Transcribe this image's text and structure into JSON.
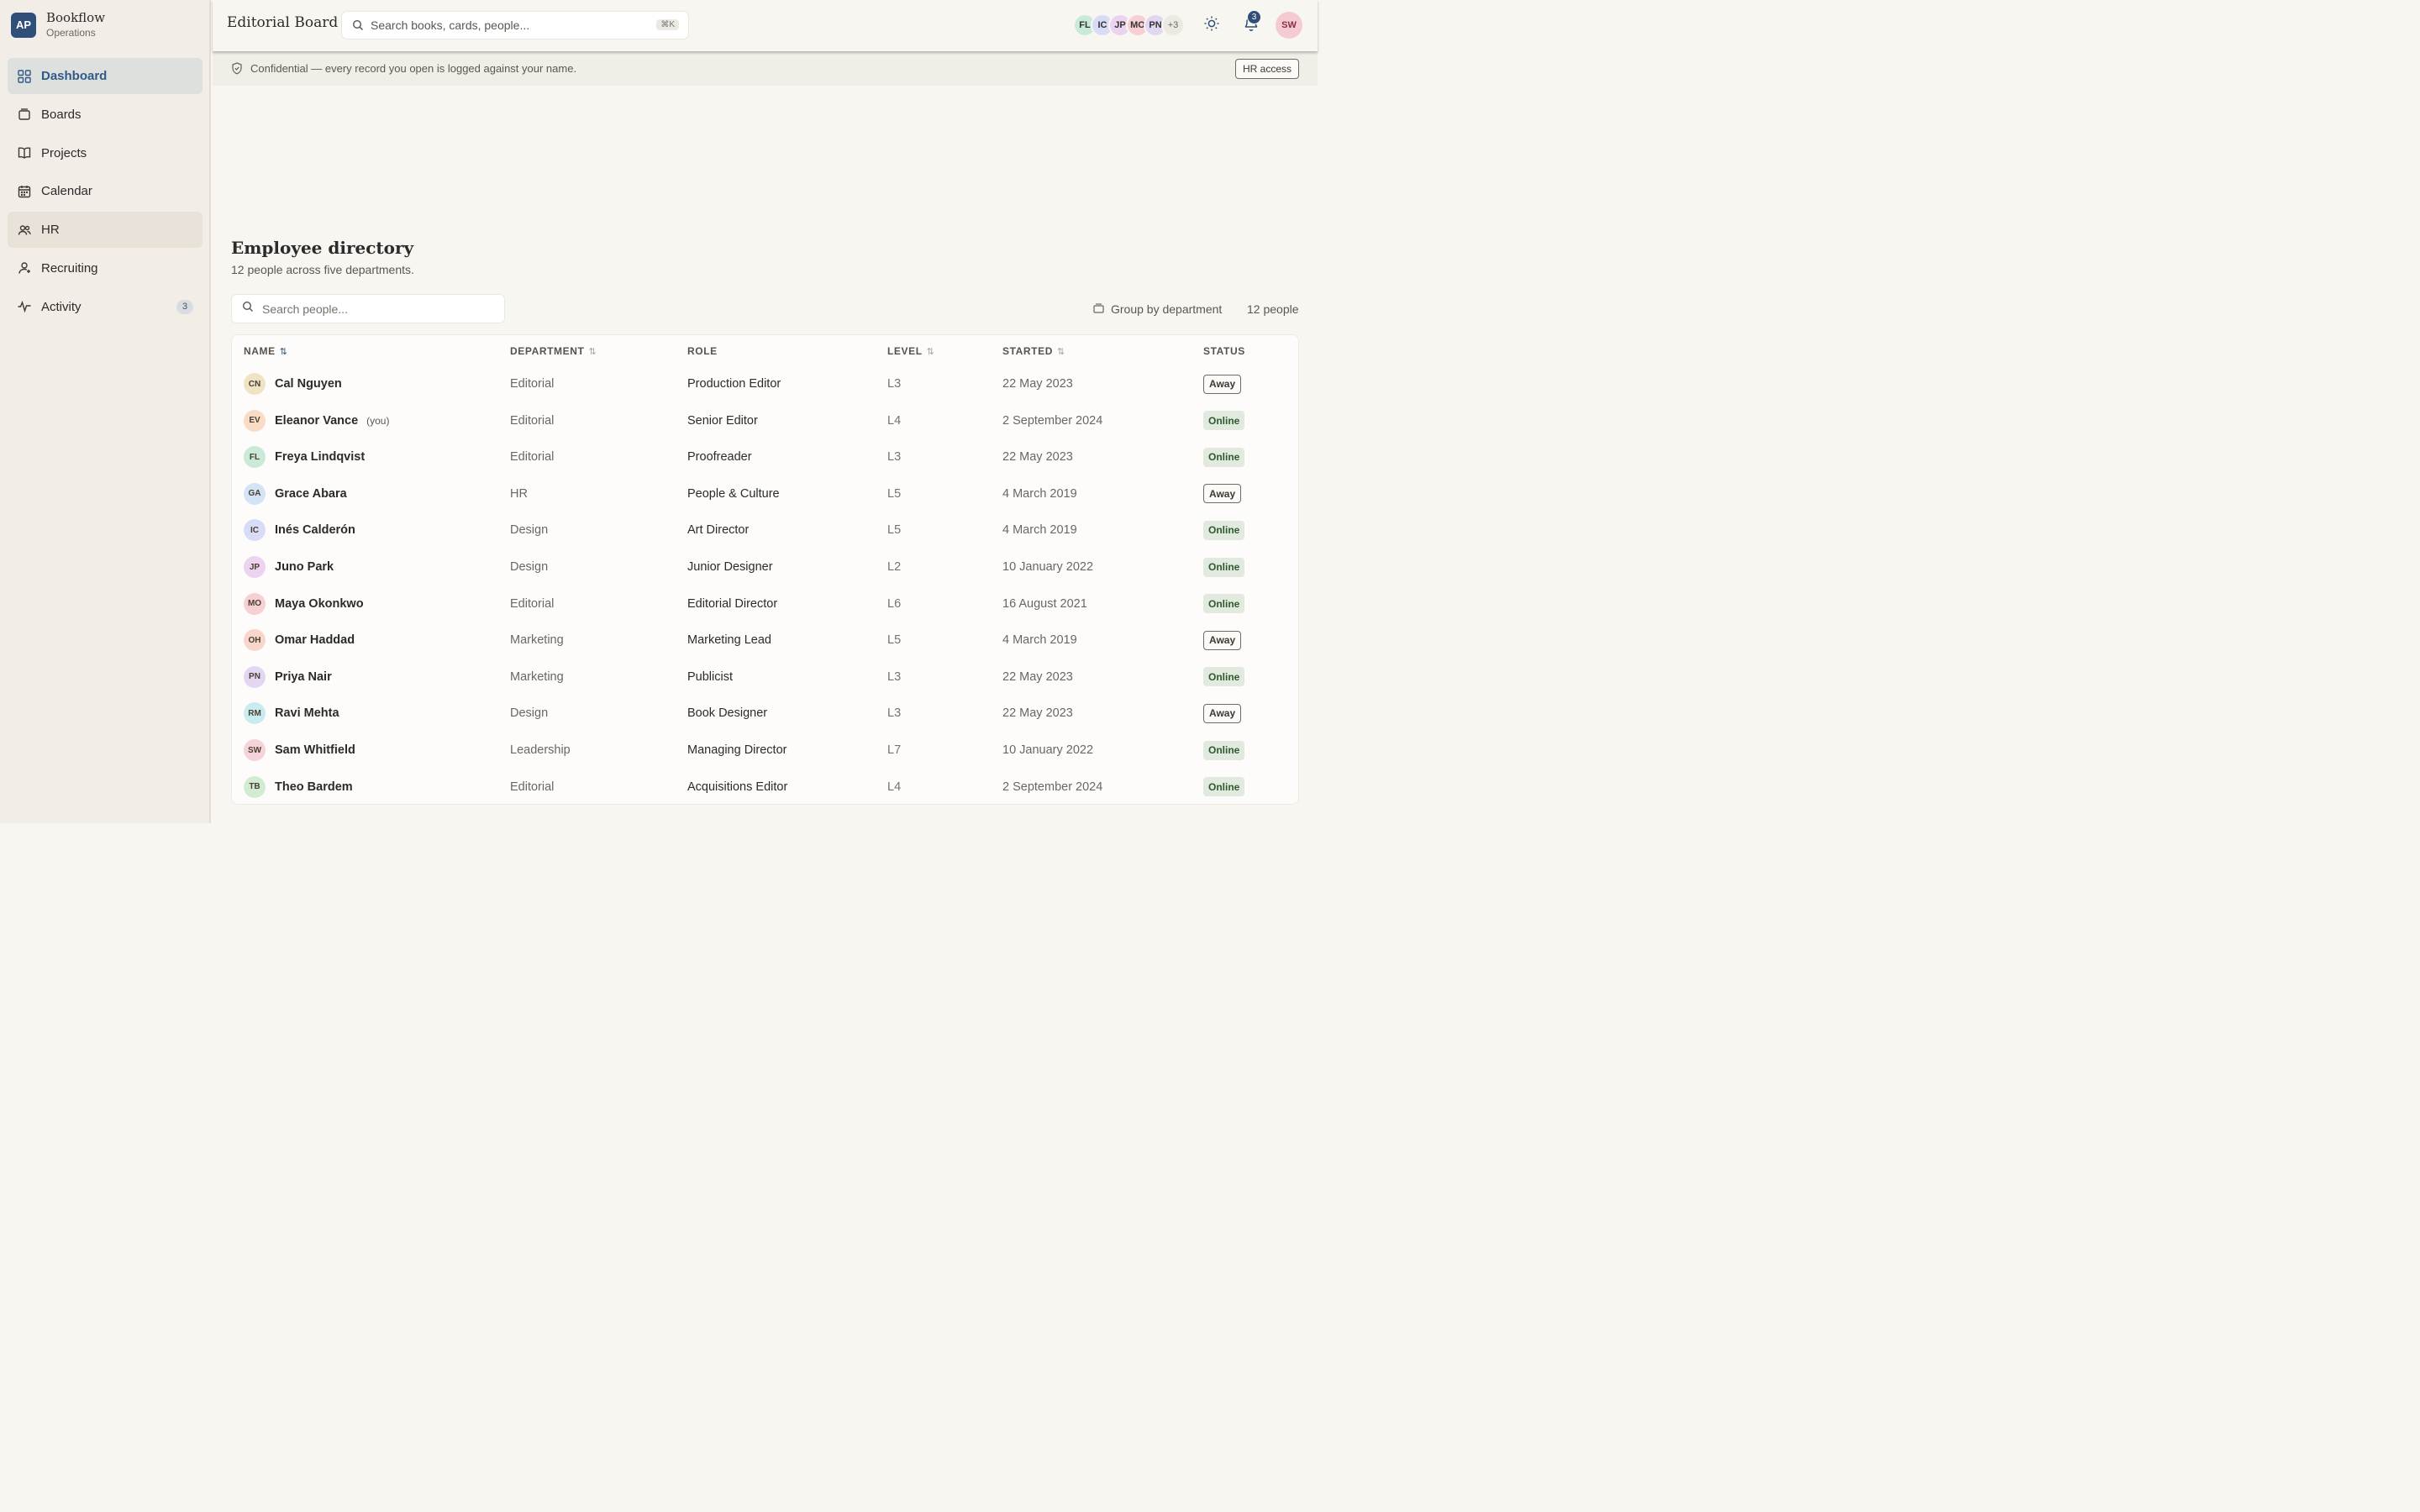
{
  "brand": {
    "logo": "AP",
    "name": "Bookflow",
    "subtitle": "Operations"
  },
  "sidebar": {
    "items": [
      {
        "label": "Dashboard",
        "icon": "grid-icon",
        "state": "active"
      },
      {
        "label": "Boards",
        "icon": "boards-icon",
        "state": ""
      },
      {
        "label": "Projects",
        "icon": "book-icon",
        "state": ""
      },
      {
        "label": "Calendar",
        "icon": "calendar-icon",
        "state": ""
      },
      {
        "label": "HR",
        "icon": "people-icon",
        "state": "selected"
      },
      {
        "label": "Recruiting",
        "icon": "user-plus-icon",
        "state": ""
      },
      {
        "label": "Activity",
        "icon": "activity-icon",
        "state": "",
        "badge": "3"
      }
    ]
  },
  "header": {
    "title": "Editorial Board",
    "search_placeholder": "Search books, cards, people...",
    "shortcut": "⌘K",
    "presence": [
      {
        "initials": "FL",
        "color": "#c9ead9"
      },
      {
        "initials": "IC",
        "color": "#d9dcf6"
      },
      {
        "initials": "JP",
        "color": "#ecd3f0"
      },
      {
        "initials": "MO",
        "color": "#f6d0d4"
      },
      {
        "initials": "PN",
        "color": "#e3d6f2"
      },
      {
        "initials": "+3",
        "color": "#ece9e3"
      }
    ],
    "notification_count": "3",
    "user_initials": "SW"
  },
  "banner": {
    "text": "Confidential — every record you open is logged against your name.",
    "button": "HR access"
  },
  "directory": {
    "title": "Employee directory",
    "subtitle": "12 people across five departments.",
    "search_placeholder": "Search people...",
    "group_label": "Group by department",
    "count_label": "12 people",
    "columns": {
      "name": "NAME",
      "department": "DEPARTMENT",
      "role": "ROLE",
      "level": "LEVEL",
      "started": "STARTED",
      "status": "STATUS"
    },
    "rows": [
      {
        "initials": "CN",
        "color": "#efe3c6",
        "name": "Cal Nguyen",
        "you": "",
        "department": "Editorial",
        "role": "Production Editor",
        "level": "L3",
        "started": "22 May 2023",
        "status": "Away",
        "status_kind": "away"
      },
      {
        "initials": "EV",
        "color": "#f8dcc6",
        "name": "Eleanor Vance",
        "you": "(you)",
        "department": "Editorial",
        "role": "Senior Editor",
        "level": "L4",
        "started": "2 September 2024",
        "status": "Online",
        "status_kind": "online"
      },
      {
        "initials": "FL",
        "color": "#c9ead9",
        "name": "Freya Lindqvist",
        "you": "",
        "department": "Editorial",
        "role": "Proofreader",
        "level": "L3",
        "started": "22 May 2023",
        "status": "Online",
        "status_kind": "online"
      },
      {
        "initials": "GA",
        "color": "#d3e4f6",
        "name": "Grace Abara",
        "you": "",
        "department": "HR",
        "role": "People & Culture",
        "level": "L5",
        "started": "4 March 2019",
        "status": "Away",
        "status_kind": "away"
      },
      {
        "initials": "IC",
        "color": "#d9dcf6",
        "name": "Inés Calderón",
        "you": "",
        "department": "Design",
        "role": "Art Director",
        "level": "L5",
        "started": "4 March 2019",
        "status": "Online",
        "status_kind": "online"
      },
      {
        "initials": "JP",
        "color": "#ecd3f0",
        "name": "Juno Park",
        "you": "",
        "department": "Design",
        "role": "Junior Designer",
        "level": "L2",
        "started": "10 January 2022",
        "status": "Online",
        "status_kind": "online"
      },
      {
        "initials": "MO",
        "color": "#f6d0d4",
        "name": "Maya Okonkwo",
        "you": "",
        "department": "Editorial",
        "role": "Editorial Director",
        "level": "L6",
        "started": "16 August 2021",
        "status": "Online",
        "status_kind": "online"
      },
      {
        "initials": "OH",
        "color": "#f8d6cc",
        "name": "Omar Haddad",
        "you": "",
        "department": "Marketing",
        "role": "Marketing Lead",
        "level": "L5",
        "started": "4 March 2019",
        "status": "Away",
        "status_kind": "away"
      },
      {
        "initials": "PN",
        "color": "#e3d6f2",
        "name": "Priya Nair",
        "you": "",
        "department": "Marketing",
        "role": "Publicist",
        "level": "L3",
        "started": "22 May 2023",
        "status": "Online",
        "status_kind": "online"
      },
      {
        "initials": "RM",
        "color": "#c8ecef",
        "name": "Ravi Mehta",
        "you": "",
        "department": "Design",
        "role": "Book Designer",
        "level": "L3",
        "started": "22 May 2023",
        "status": "Away",
        "status_kind": "away"
      },
      {
        "initials": "SW",
        "color": "#f6d2da",
        "name": "Sam Whitfield",
        "you": "",
        "department": "Leadership",
        "role": "Managing Director",
        "level": "L7",
        "started": "10 January 2022",
        "status": "Online",
        "status_kind": "online"
      },
      {
        "initials": "TB",
        "color": "#d2ecd3",
        "name": "Theo Bardem",
        "you": "",
        "department": "Editorial",
        "role": "Acquisitions Editor",
        "level": "L4",
        "started": "2 September 2024",
        "status": "Online",
        "status_kind": "online"
      }
    ]
  }
}
